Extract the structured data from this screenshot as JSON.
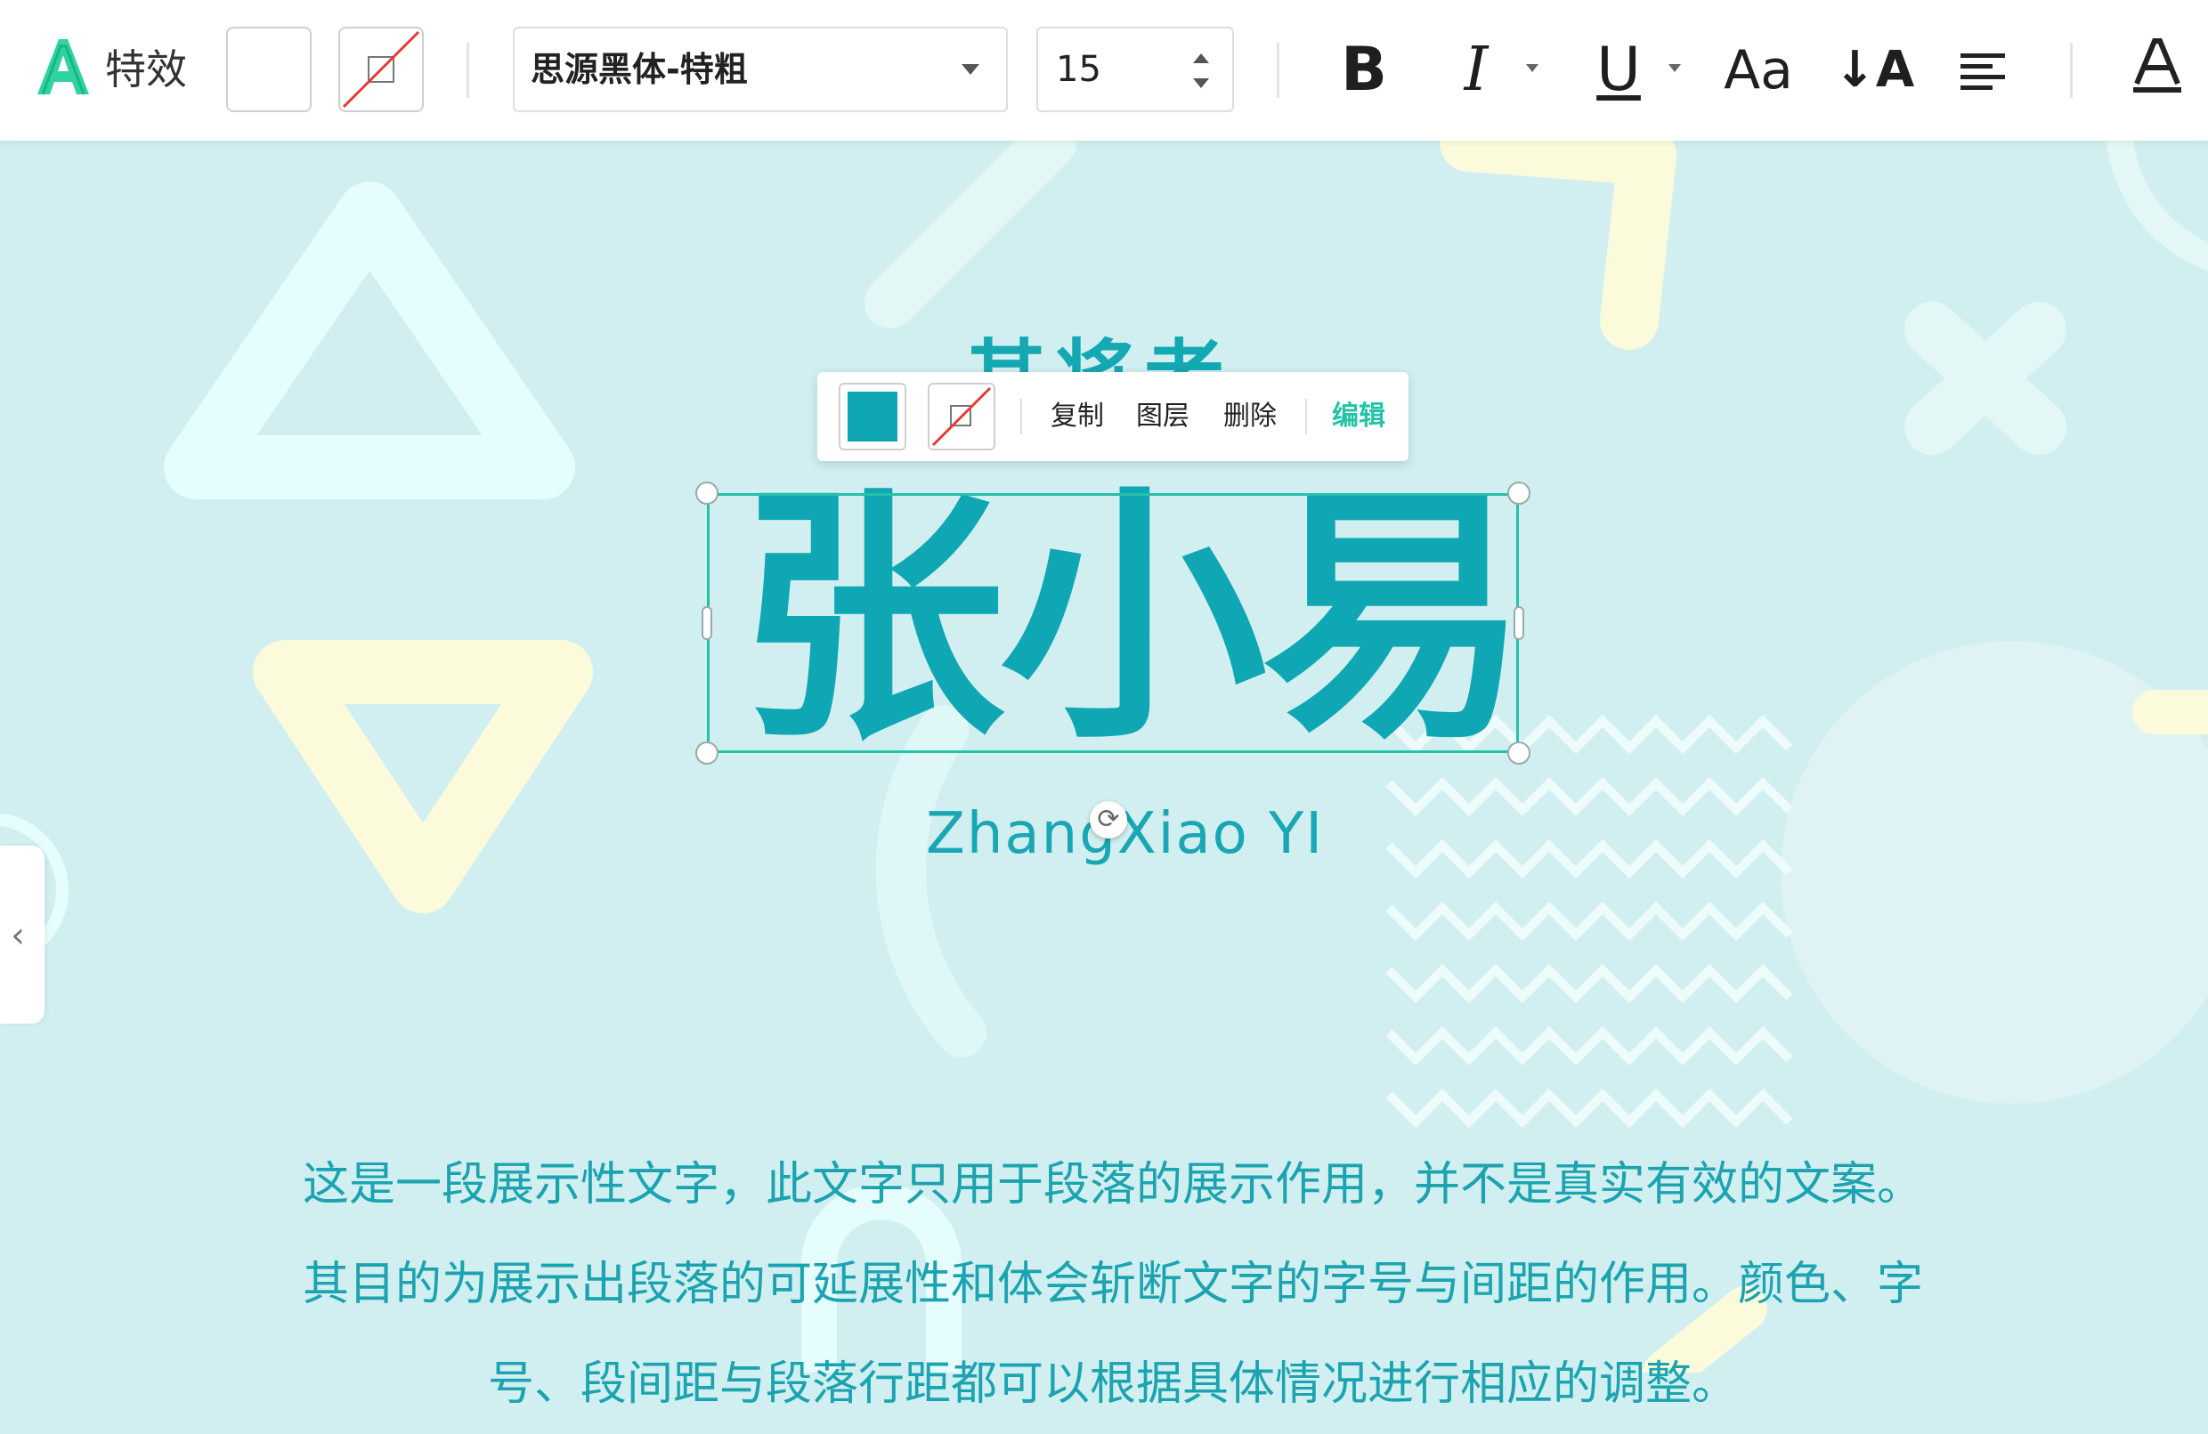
{
  "toolbar": {
    "effects_label": "特效",
    "font_family": "思源黑体-特粗",
    "font_size": "15",
    "bold_label": "B",
    "italic_label": "I",
    "underline_label": "U",
    "case_label": "Aa",
    "line_spacing_label": "↓A",
    "align_icon": "align-left-icon",
    "text_color_icon": "text-color-icon",
    "fill_color": "#ffffff",
    "stroke_color": "none"
  },
  "context_menu": {
    "fill_color": "#0fa7b3",
    "stroke_color": "none",
    "copy_label": "复制",
    "layer_label": "图层",
    "delete_label": "删除",
    "edit_label": "编辑"
  },
  "canvas": {
    "ghost_title": "其将者",
    "name": "张小易",
    "pinyin": "ZhangXiao YI",
    "paragraph_lines": [
      "这是一段展示性文字，此文字只用于段落的展示作用，并不是真实有效的文案。",
      "其目的为展示出段落的可延展性和体会斩断文字的字号与间距的作用。颜色、字",
      "号、段间距与段落行距都可以根据具体情况进行相应的调整。"
    ],
    "accent_color": "#0fa7b3",
    "background_color": "#d1eff0"
  },
  "side_panel": {
    "collapse_icon": "chevron-left-icon"
  }
}
